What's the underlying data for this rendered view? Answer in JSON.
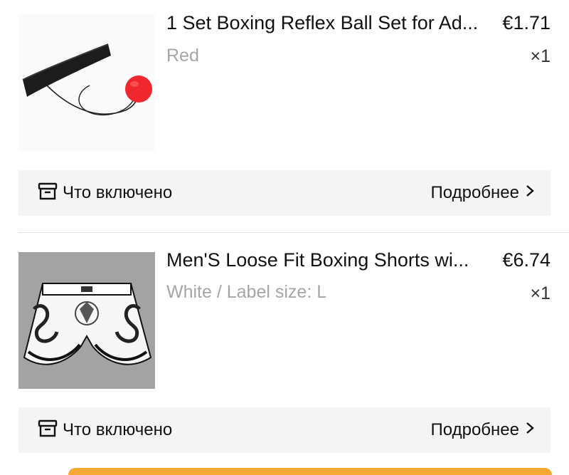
{
  "cart": {
    "items": [
      {
        "image": "boxing-reflex-ball-headband",
        "title": "1 Set Boxing Reflex Ball Set for Ad...",
        "price": "€1.71",
        "variant": "Red",
        "quantity": "×1",
        "included_label": "Что включено",
        "details_label": "Подробнее"
      },
      {
        "image": "white-dragon-boxing-shorts",
        "title": "Men'S Loose Fit Boxing Shorts wi...",
        "price": "€6.74",
        "variant": "White / Label size: L",
        "quantity": "×1",
        "included_label": "Что включено",
        "details_label": "Подробнее"
      }
    ]
  },
  "icons": {
    "included": "box-icon",
    "details": "chevron-right-icon"
  },
  "colors": {
    "ball": "#f0272d",
    "muted_text": "#a6a6a6",
    "bar_background": "#f4f4f4",
    "checkout_button": "#f7a733"
  }
}
